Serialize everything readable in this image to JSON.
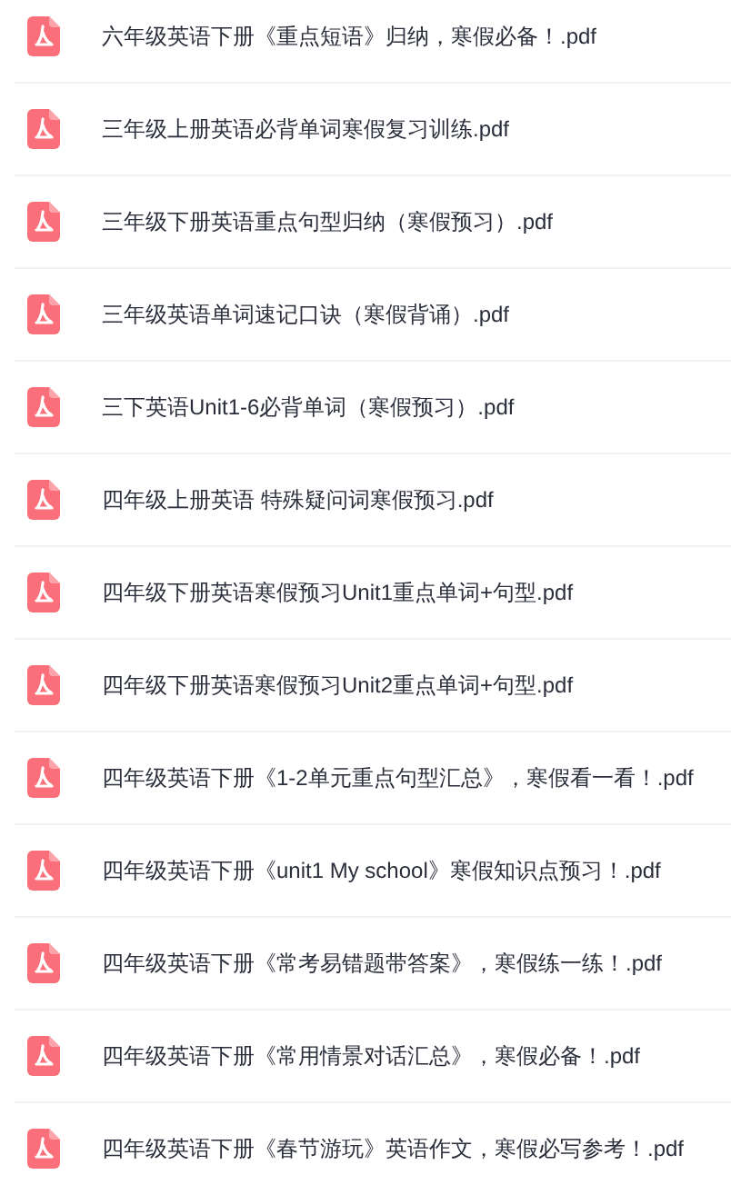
{
  "files": [
    {
      "name": "六年级英语下册《重点短语》归纳，寒假必备！.pdf"
    },
    {
      "name": "三年级上册英语必背单词寒假复习训练.pdf"
    },
    {
      "name": "三年级下册英语重点句型归纳（寒假预习）.pdf"
    },
    {
      "name": "三年级英语单词速记口诀（寒假背诵）.pdf"
    },
    {
      "name": "三下英语Unit1-6必背单词（寒假预习）.pdf"
    },
    {
      "name": "四年级上册英语 特殊疑问词寒假预习.pdf"
    },
    {
      "name": "四年级下册英语寒假预习Unit1重点单词+句型.pdf"
    },
    {
      "name": "四年级下册英语寒假预习Unit2重点单词+句型.pdf"
    },
    {
      "name": "四年级英语下册《1-2单元重点句型汇总》，寒假看一看！.pdf"
    },
    {
      "name": "四年级英语下册《unit1 My school》寒假知识点预习！.pdf"
    },
    {
      "name": "四年级英语下册《常考易错题带答案》，寒假练一练！.pdf"
    },
    {
      "name": "四年级英语下册《常用情景对话汇总》，寒假必备！.pdf"
    },
    {
      "name": "四年级英语下册《春节游玩》英语作文，寒假必写参考！.pdf"
    }
  ]
}
